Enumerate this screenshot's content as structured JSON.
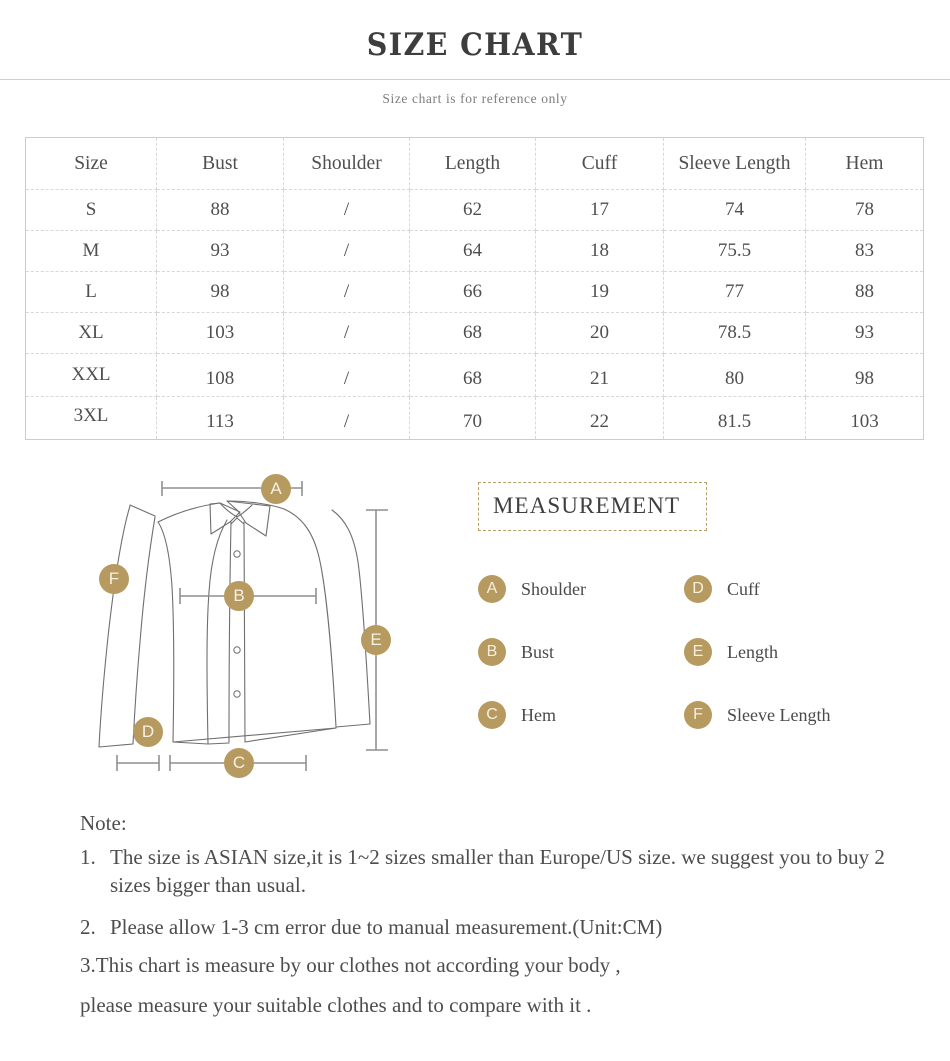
{
  "header": {
    "title": "SIZE CHART",
    "subtitle": "Size chart is for reference only"
  },
  "table": {
    "columns": [
      "Size",
      "Bust",
      "Shoulder",
      "Length",
      "Cuff",
      "Sleeve Length",
      "Hem"
    ],
    "rows": [
      {
        "size": "S",
        "bust": "88",
        "shoulder": "/",
        "length": "62",
        "cuff": "17",
        "sleeve": "74",
        "hem": "78"
      },
      {
        "size": "M",
        "bust": "93",
        "shoulder": "/",
        "length": "64",
        "cuff": "18",
        "sleeve": "75.5",
        "hem": "83"
      },
      {
        "size": "L",
        "bust": "98",
        "shoulder": "/",
        "length": "66",
        "cuff": "19",
        "sleeve": "77",
        "hem": "88"
      },
      {
        "size": "XL",
        "bust": "103",
        "shoulder": "/",
        "length": "68",
        "cuff": "20",
        "sleeve": "78.5",
        "hem": "93"
      },
      {
        "size": "XXL",
        "bust": "108",
        "shoulder": "/",
        "length": "68",
        "cuff": "21",
        "sleeve": "80",
        "hem": "98"
      },
      {
        "size": "3XL",
        "bust": "113",
        "shoulder": "/",
        "length": "70",
        "cuff": "22",
        "sleeve": "81.5",
        "hem": "103"
      }
    ]
  },
  "measurement": {
    "box_title": "MEASUREMENT",
    "legend": [
      {
        "key": "A",
        "label": "Shoulder"
      },
      {
        "key": "D",
        "label": "Cuff"
      },
      {
        "key": "B",
        "label": "Bust"
      },
      {
        "key": "E",
        "label": "Length"
      },
      {
        "key": "C",
        "label": "Hem"
      },
      {
        "key": "F",
        "label": "Sleeve Length"
      }
    ]
  },
  "diagram": {
    "markers": [
      "A",
      "B",
      "C",
      "D",
      "E",
      "F"
    ]
  },
  "notes": {
    "heading": "Note:",
    "items": [
      {
        "marker": "1.",
        "text": "The size is ASIAN size,it is 1~2 sizes smaller than Europe/US size. we suggest you to buy 2 sizes bigger than usual."
      },
      {
        "marker": "2.",
        "text": "Please allow 1-3 cm error due to manual measurement.(Unit:CM)"
      }
    ],
    "line3": "3.This chart is measure by our clothes not according your body ,",
    "line4": "please measure your suitable clothes and to compare with it ."
  },
  "colors": {
    "accent_gold": "#b69a5f",
    "text": "#4a4a4a",
    "rule": "#cfcfcf",
    "table_border": "#d8d8d8"
  }
}
